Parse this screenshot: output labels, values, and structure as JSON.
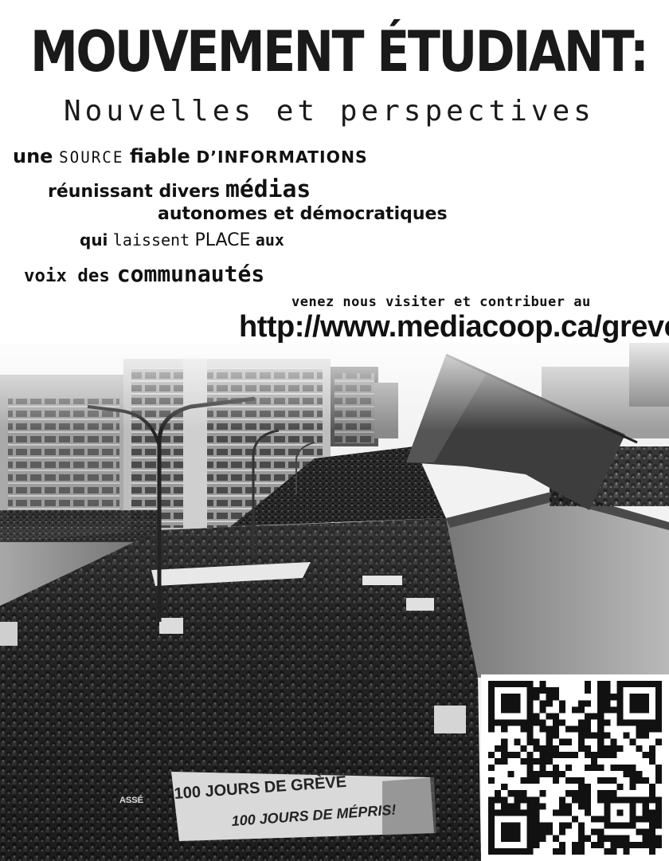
{
  "poster": {
    "title": "MOUVEMENT ÉTUDIANT:",
    "subtitle": "Nouvelles et perspectives",
    "lines": {
      "l1": {
        "a": "une",
        "b": "SOURCE",
        "c": "fiable",
        "d": "D’INFORMATIONS"
      },
      "l2": {
        "a": "réunissant divers",
        "b": "médias"
      },
      "l3": {
        "a": "autonomes et démocratiques"
      },
      "l4": {
        "a": "qui",
        "b": "laissent",
        "c": "PLACE",
        "d": "aux"
      },
      "l5": {
        "a": "voix des",
        "b": "communautés"
      }
    },
    "visit_text": "venez nous visiter et contribuer au",
    "url": "http://www.mediacoop.ca/greve",
    "banner": {
      "line1": "100 JOURS DE GRÈVE",
      "line2": "100 JOURS DE MÉPRIS!",
      "badge": "ASSÉ"
    }
  },
  "colors": {
    "background": "#ffffff",
    "text": "#111111",
    "photo_dark": "#1c1c1c",
    "photo_mid": "#8a8a8a",
    "flag": "#3a3a3a"
  }
}
